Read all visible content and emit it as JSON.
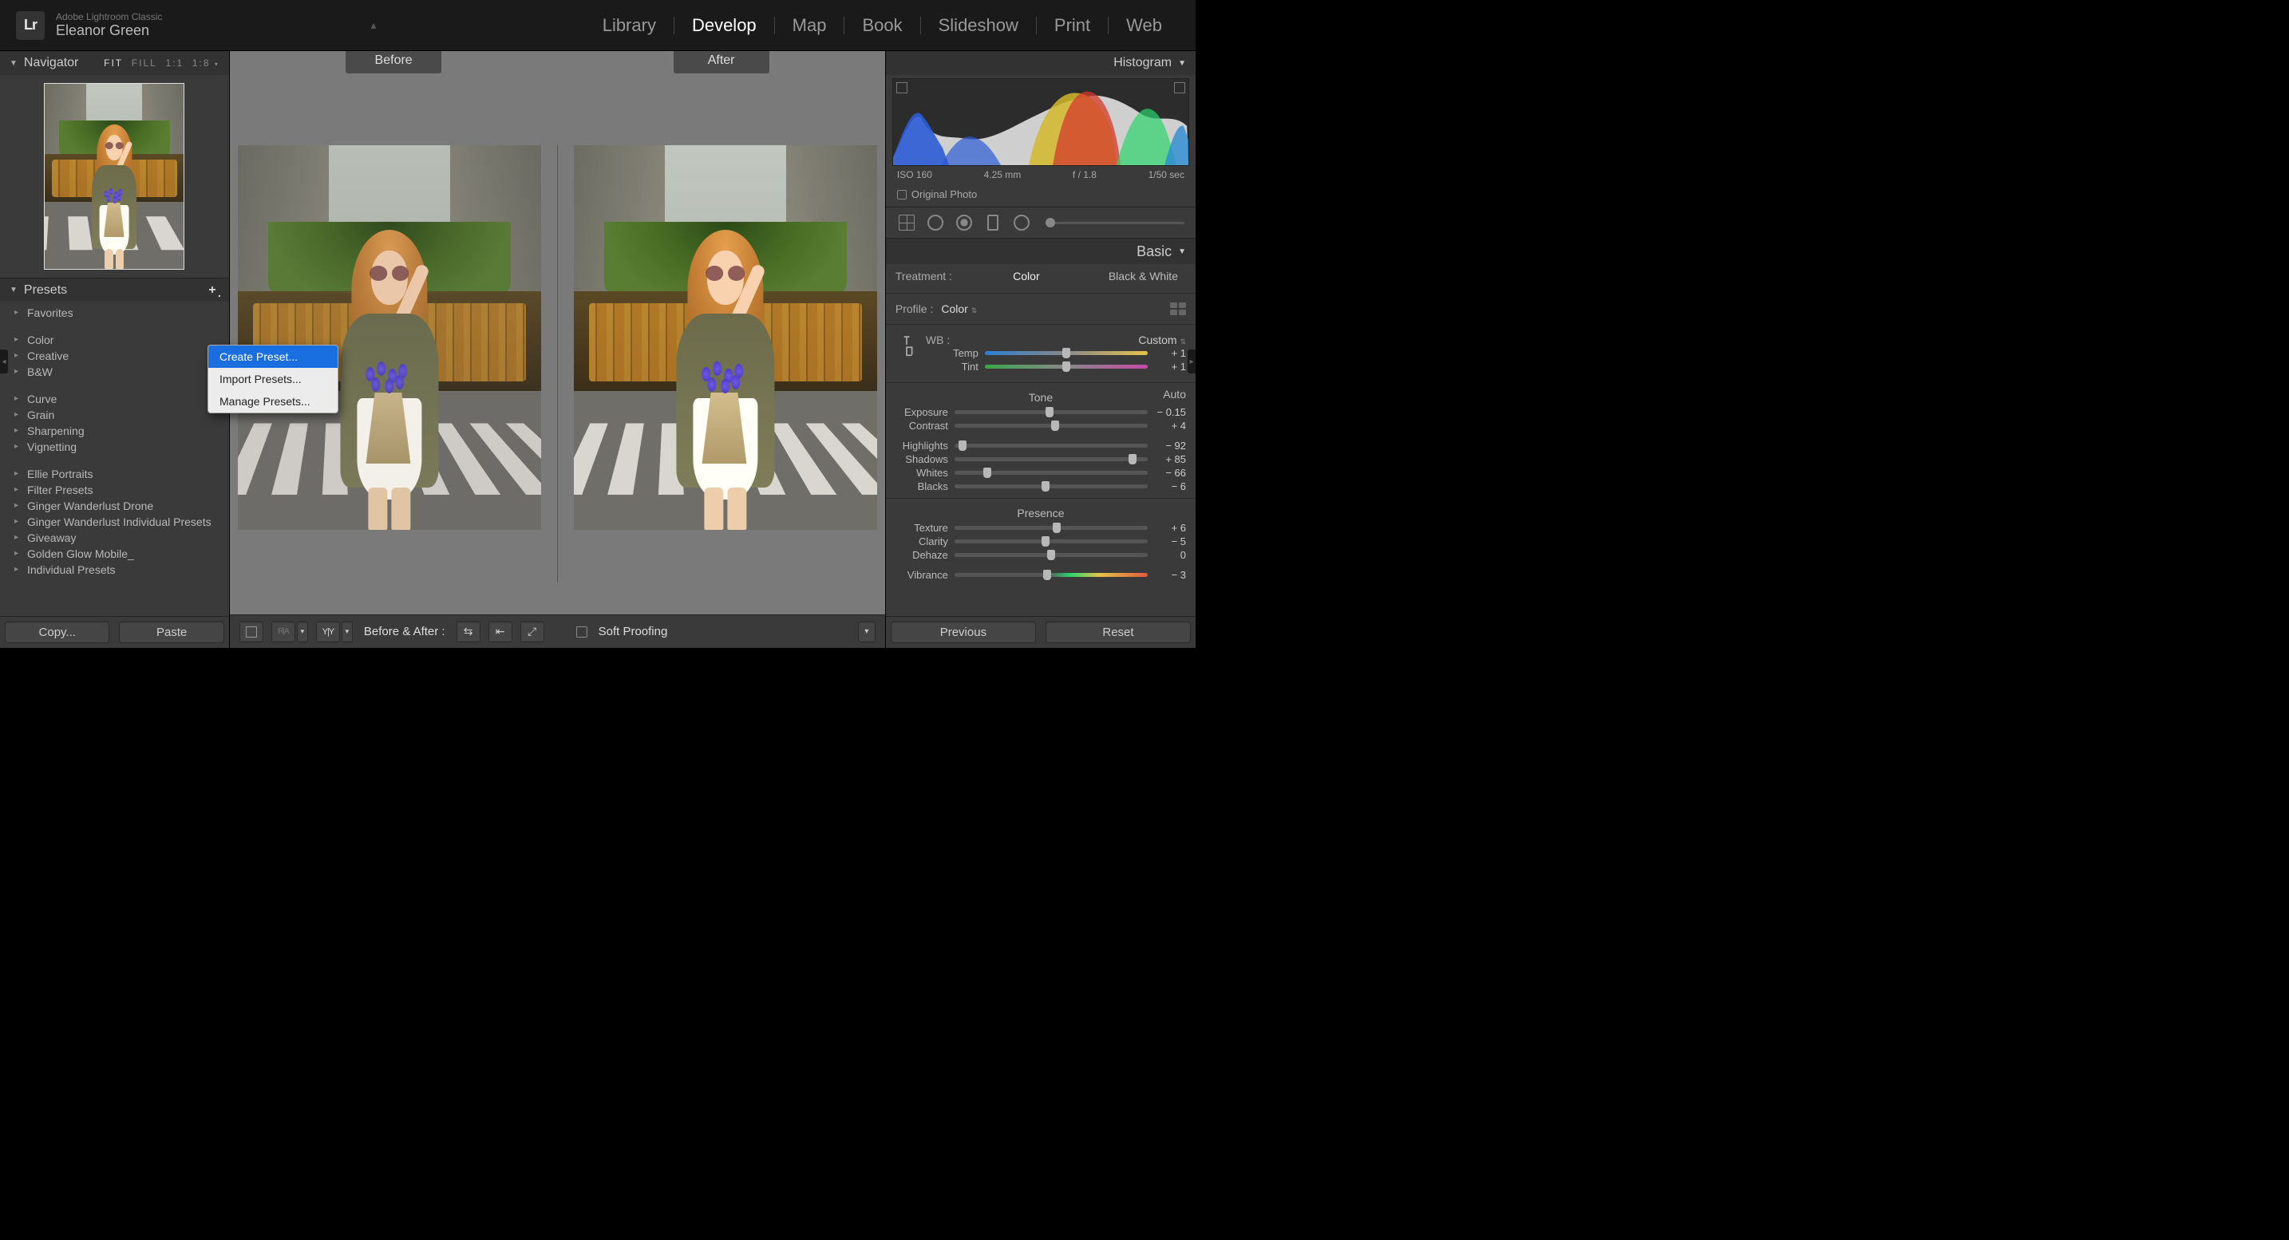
{
  "app": {
    "name": "Adobe Lightroom Classic",
    "user": "Eleanor Green",
    "logo": "Lr"
  },
  "modules": {
    "items": [
      "Library",
      "Develop",
      "Map",
      "Book",
      "Slideshow",
      "Print",
      "Web"
    ],
    "active": "Develop"
  },
  "navigator": {
    "title": "Navigator",
    "zoom": {
      "fit": "FIT",
      "fill": "FILL",
      "one": "1:1",
      "custom": "1:8"
    }
  },
  "presets": {
    "title": "Presets",
    "groups1": [
      "Favorites"
    ],
    "groups2": [
      "Color",
      "Creative",
      "B&W"
    ],
    "groups3": [
      "Curve",
      "Grain",
      "Sharpening",
      "Vignetting"
    ],
    "groups4": [
      "Ellie Portraits",
      "Filter Presets",
      "Ginger Wanderlust Drone",
      "Ginger Wanderlust Individual Presets",
      "Giveaway",
      "Golden Glow Mobile_",
      "Individual Presets"
    ]
  },
  "preset_menu": {
    "items": [
      "Create Preset...",
      "Import Presets...",
      "Manage Presets..."
    ],
    "selected": 0
  },
  "left_footer": {
    "copy": "Copy...",
    "paste": "Paste"
  },
  "center": {
    "before": "Before",
    "after": "After",
    "footer": {
      "ba_label": "Before & After :",
      "soft_proof": "Soft Proofing"
    }
  },
  "histogram": {
    "title": "Histogram",
    "meta": {
      "iso": "ISO 160",
      "focal": "4.25 mm",
      "aperture": "f / 1.8",
      "shutter": "1/50 sec"
    },
    "original": "Original Photo"
  },
  "basic": {
    "title": "Basic",
    "treatment_label": "Treatment :",
    "treatment_color": "Color",
    "treatment_bw": "Black & White",
    "profile_label": "Profile :",
    "profile_value": "Color",
    "wb_label": "WB :",
    "wb_value": "Custom",
    "tone_label": "Tone",
    "auto": "Auto",
    "presence_label": "Presence",
    "sliders": {
      "temp": {
        "label": "Temp",
        "value": "+ 1",
        "pos": 50
      },
      "tint": {
        "label": "Tint",
        "value": "+ 1",
        "pos": 50
      },
      "exposure": {
        "label": "Exposure",
        "value": "− 0.15",
        "pos": 49
      },
      "contrast": {
        "label": "Contrast",
        "value": "+ 4",
        "pos": 52
      },
      "highlights": {
        "label": "Highlights",
        "value": "− 92",
        "pos": 4
      },
      "shadows": {
        "label": "Shadows",
        "value": "+ 85",
        "pos": 92
      },
      "whites": {
        "label": "Whites",
        "value": "− 66",
        "pos": 17
      },
      "blacks": {
        "label": "Blacks",
        "value": "− 6",
        "pos": 47
      },
      "texture": {
        "label": "Texture",
        "value": "+ 6",
        "pos": 53
      },
      "clarity": {
        "label": "Clarity",
        "value": "− 5",
        "pos": 47
      },
      "dehaze": {
        "label": "Dehaze",
        "value": "0",
        "pos": 50
      },
      "vibrance": {
        "label": "Vibrance",
        "value": "− 3",
        "pos": 48
      }
    }
  },
  "right_footer": {
    "previous": "Previous",
    "reset": "Reset"
  }
}
